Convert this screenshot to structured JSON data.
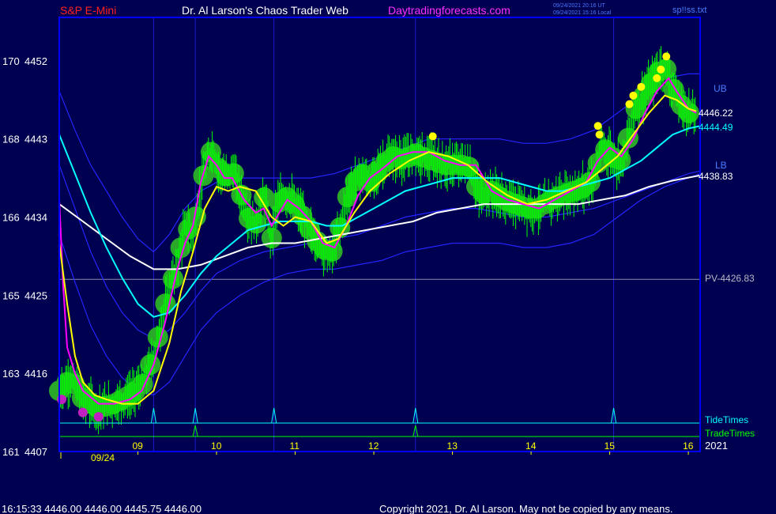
{
  "header": {
    "symbol": "S&P E-Mini",
    "site_title": "Dr. Al Larson's Chaos Trader Web",
    "url": "Daytradingforecasts.com",
    "utc_stamp": "09/24/2021 20:16 UT",
    "local_stamp": "09/24/2021 15:16 Local",
    "file_name": "sp!!ss.txt"
  },
  "footer": {
    "quote_line": "16:15:33  4446.00 4446.00 4445.75 4446.00",
    "copyright": "Copyright 2021, Dr. Al Larson. May not be copied by any means."
  },
  "colors": {
    "background": "#000050",
    "axis": "#0000ff",
    "grid": "#1a1ad0",
    "price_bars": "#00ff00",
    "halo": "#2aa82a",
    "magenta_ma": "#ff00ff",
    "yellow_ma": "#ffff00",
    "cyan_ma": "#00ffff",
    "white_ma": "#ffffff",
    "band": "#2424ff",
    "red_label": "#ff2020",
    "white_label": "#ffffff",
    "magenta_label": "#ff30ff",
    "band_label": "#4a7aff"
  },
  "chart_data": {
    "type": "line",
    "y_range_price": [
      4407,
      4457
    ],
    "left_axis_labels": [
      {
        "code": "170",
        "price": "4452"
      },
      {
        "code": "168",
        "price": "4443"
      },
      {
        "code": "166",
        "price": "4434"
      },
      {
        "code": "165",
        "price": "4425"
      },
      {
        "code": "163",
        "price": "4416"
      },
      {
        "code": "161",
        "price": "4407"
      }
    ],
    "x_range_hours": [
      8.0,
      16.15
    ],
    "x_tick_labels": [
      "09",
      "10",
      "11",
      "12",
      "13",
      "14",
      "15",
      "16"
    ],
    "x_tick_hours": [
      9,
      10,
      11,
      12,
      13,
      14,
      15,
      16
    ],
    "date_label": "09/24",
    "year_label": "2021",
    "vertical_lines_hours": [
      9.2,
      9.73,
      10.73,
      12.53,
      15.05
    ],
    "pivot": {
      "label": "PV-4426.83",
      "price": 4426.83
    },
    "right_labels": {
      "upper_band": "UB",
      "lower_band": "LB",
      "price_a": "4446.22",
      "price_b": "4444.49",
      "price_c": "4438.83"
    },
    "tide_times": {
      "label": "TideTimes",
      "spike_hours": [
        9.2,
        9.73,
        10.73,
        12.53,
        15.05
      ]
    },
    "trade_times": {
      "label": "TradeTimes",
      "spike_hours": [
        9.73,
        12.53
      ]
    },
    "price_series": {
      "hours": [
        8.0,
        8.15,
        8.3,
        8.5,
        8.7,
        8.9,
        9.05,
        9.2,
        9.35,
        9.5,
        9.6,
        9.7,
        9.78,
        9.85,
        9.95,
        10.0,
        10.1,
        10.2,
        10.3,
        10.4,
        10.5,
        10.6,
        10.7,
        10.75,
        10.85,
        10.95,
        11.1,
        11.25,
        11.35,
        11.45,
        11.55,
        11.65,
        11.75,
        11.85,
        11.95,
        12.1,
        12.25,
        12.4,
        12.5,
        12.6,
        12.75,
        12.9,
        13.05,
        13.2,
        13.35,
        13.5,
        13.65,
        13.8,
        13.95,
        14.1,
        14.25,
        14.4,
        14.55,
        14.7,
        14.8,
        14.9,
        15.0,
        15.1,
        15.2,
        15.3,
        15.4,
        15.5,
        15.6,
        15.7,
        15.8,
        15.9,
        16.0,
        16.1
      ],
      "close": [
        4414.0,
        4415.5,
        4413.0,
        4412.0,
        4412.5,
        4413.5,
        4414.5,
        4418.0,
        4424.0,
        4428.5,
        4433.0,
        4432.0,
        4436.5,
        4439.5,
        4442.0,
        4440.0,
        4438.5,
        4439.5,
        4437.0,
        4434.0,
        4433.0,
        4436.5,
        4431.5,
        4435.0,
        4436.5,
        4436.0,
        4434.0,
        4431.5,
        4430.5,
        4429.5,
        4432.0,
        4436.0,
        4438.0,
        4439.0,
        4438.0,
        4440.0,
        4441.0,
        4440.5,
        4441.5,
        4441.0,
        4440.5,
        4440.0,
        4440.0,
        4440.0,
        4436.5,
        4437.0,
        4436.0,
        4435.5,
        4435.0,
        4435.0,
        4436.0,
        4436.5,
        4437.0,
        4437.5,
        4438.5,
        4442.0,
        4441.5,
        4440.0,
        4441.5,
        4446.0,
        4447.5,
        4449.0,
        4450.5,
        4451.5,
        4449.0,
        4447.0,
        4446.0,
        4446.0
      ],
      "yellow_dot_hours": [
        12.75,
        14.85,
        14.87,
        15.25,
        15.3,
        15.4,
        15.6,
        15.65,
        15.72
      ],
      "yellow_dot_prices": [
        4443.3,
        4444.5,
        4443.5,
        4447.0,
        4448.0,
        4449.0,
        4450.0,
        4451.0,
        4452.5
      ],
      "magenta_dot_hours": [
        8.03,
        8.3,
        8.5
      ],
      "magenta_dot_prices": [
        4413.0,
        4411.5,
        4411.0
      ]
    },
    "yellow_ma": {
      "hours": [
        8.0,
        8.1,
        8.2,
        8.3,
        8.45,
        8.6,
        8.8,
        9.0,
        9.2,
        9.4,
        9.55,
        9.7,
        9.85,
        10.0,
        10.15,
        10.3,
        10.5,
        10.7,
        10.85,
        11.0,
        11.2,
        11.4,
        11.55,
        11.75,
        11.95,
        12.2,
        12.45,
        12.7,
        12.95,
        13.2,
        13.45,
        13.7,
        13.95,
        14.2,
        14.45,
        14.7,
        14.9,
        15.1,
        15.3,
        15.5,
        15.7,
        15.85,
        16.0,
        16.1
      ],
      "values": [
        4431,
        4424,
        4418,
        4415,
        4413.5,
        4413,
        4412.5,
        4412.5,
        4414,
        4419.5,
        4425.5,
        4430,
        4435,
        4437.5,
        4437,
        4437.5,
        4437,
        4434,
        4433,
        4434,
        4433.5,
        4431,
        4431.5,
        4434.5,
        4437,
        4439,
        4440.5,
        4441.5,
        4441,
        4440,
        4438,
        4436.5,
        4435.5,
        4436,
        4437,
        4438,
        4439.5,
        4441,
        4443.5,
        4446,
        4448,
        4447.5,
        4446.5,
        4446.2
      ]
    },
    "magenta_ma": {
      "hours": [
        8.0,
        8.05,
        8.1,
        8.2,
        8.3,
        8.5,
        8.7,
        8.9,
        9.05,
        9.2,
        9.35,
        9.5,
        9.6,
        9.7,
        9.8,
        9.9,
        10.0,
        10.1,
        10.2,
        10.35,
        10.5,
        10.6,
        10.7,
        10.8,
        10.9,
        11.05,
        11.2,
        11.35,
        11.5,
        11.65,
        11.8,
        11.95,
        12.1,
        12.3,
        12.5,
        12.7,
        12.9,
        13.1,
        13.3,
        13.5,
        13.7,
        13.9,
        14.1,
        14.3,
        14.5,
        14.7,
        14.85,
        15.0,
        15.15,
        15.3,
        15.45,
        15.6,
        15.75,
        15.85,
        16.0,
        16.1
      ],
      "values": [
        4436,
        4426,
        4419,
        4416,
        4414,
        4412.5,
        4412.5,
        4413,
        4414,
        4417,
        4422,
        4428,
        4431,
        4433,
        4438,
        4441,
        4440,
        4438.5,
        4438.5,
        4436,
        4434.5,
        4435,
        4433,
        4434.5,
        4436,
        4435,
        4433.5,
        4431,
        4430.5,
        4433,
        4436.5,
        4438.5,
        4439.5,
        4441,
        4441.5,
        4441.5,
        4440.5,
        4440,
        4440,
        4437,
        4436,
        4435.5,
        4435,
        4436,
        4437,
        4438,
        4440.5,
        4442,
        4441,
        4443,
        4446,
        4448.5,
        4450,
        4448.5,
        4446.5,
        4446
      ]
    },
    "cyan_ma": {
      "hours": [
        8.0,
        8.2,
        8.4,
        8.6,
        8.8,
        9.0,
        9.2,
        9.4,
        9.6,
        9.8,
        10.0,
        10.2,
        10.4,
        10.6,
        10.8,
        11.0,
        11.2,
        11.4,
        11.6,
        11.8,
        12.0,
        12.2,
        12.4,
        12.6,
        12.8,
        13.0,
        13.2,
        13.4,
        13.6,
        13.8,
        14.0,
        14.2,
        14.4,
        14.6,
        14.8,
        15.0,
        15.2,
        15.4,
        15.6,
        15.8,
        16.0,
        16.15
      ],
      "values": [
        4443.5,
        4439,
        4434.5,
        4430.5,
        4427,
        4424,
        4422.5,
        4423,
        4425,
        4427.5,
        4429.5,
        4431,
        4432.5,
        4433,
        4433.5,
        4433.5,
        4433.5,
        4433,
        4433,
        4434,
        4435,
        4436,
        4437,
        4437.5,
        4438,
        4438.5,
        4438.5,
        4438.5,
        4438.5,
        4438,
        4437.5,
        4437,
        4437,
        4437.5,
        4438,
        4438.5,
        4439.5,
        4440.5,
        4442,
        4443.5,
        4444.2,
        4444.5
      ]
    },
    "white_ma": {
      "hours": [
        8.0,
        8.3,
        8.6,
        8.9,
        9.2,
        9.5,
        9.8,
        10.1,
        10.4,
        10.7,
        11.0,
        11.3,
        11.6,
        11.9,
        12.2,
        12.5,
        12.8,
        13.1,
        13.4,
        13.7,
        14.0,
        14.3,
        14.6,
        14.9,
        15.2,
        15.5,
        15.8,
        16.15
      ],
      "values": [
        4435.5,
        4433.5,
        4431.5,
        4429.5,
        4428,
        4428,
        4428.5,
        4429.5,
        4430.5,
        4431,
        4431,
        4431.5,
        4432,
        4432.5,
        4433,
        4433.5,
        4434.5,
        4435,
        4435.5,
        4435.5,
        4435.5,
        4435.5,
        4435.5,
        4436,
        4436.5,
        4437.5,
        4438.2,
        4438.8
      ]
    },
    "upper_band": {
      "hours": [
        8.0,
        8.2,
        8.4,
        8.6,
        8.8,
        9.0,
        9.2,
        9.4,
        9.6,
        9.8,
        10.0,
        10.3,
        10.6,
        10.9,
        11.2,
        11.5,
        11.8,
        12.1,
        12.4,
        12.7,
        13.0,
        13.3,
        13.6,
        13.9,
        14.2,
        14.5,
        14.8,
        15.1,
        15.4,
        15.7,
        16.0,
        16.15
      ],
      "values": [
        4448.5,
        4444,
        4440,
        4437,
        4434,
        4431.5,
        4430,
        4432,
        4435,
        4437,
        4438,
        4438.5,
        4438.5,
        4438.5,
        4438.5,
        4439,
        4440,
        4441,
        4442,
        4443,
        4443,
        4443,
        4443,
        4442.5,
        4442.5,
        4443,
        4444,
        4446,
        4448,
        4450,
        4450.5,
        4450.5
      ]
    },
    "mid_band": {
      "hours": [
        8.0,
        8.2,
        8.4,
        8.6,
        8.8,
        9.0,
        9.2,
        9.4,
        9.6,
        9.8,
        10.0,
        10.3,
        10.6,
        10.9,
        11.2,
        11.5,
        11.8,
        12.1,
        12.4,
        12.7,
        13.0,
        13.3,
        13.6,
        13.9,
        14.2,
        14.5,
        14.8,
        15.1,
        15.4,
        15.7,
        16.0,
        16.15
      ],
      "values": [
        4440,
        4435,
        4430,
        4426,
        4423,
        4421,
        4420,
        4421,
        4423,
        4425.5,
        4427.5,
        4429,
        4430,
        4430.5,
        4431,
        4431.5,
        4432,
        4433,
        4434,
        4434.5,
        4435,
        4435,
        4434.5,
        4434,
        4434,
        4434.5,
        4435,
        4436,
        4437,
        4438,
        4439,
        4439.3
      ]
    },
    "lower_band": {
      "hours": [
        8.0,
        8.2,
        8.4,
        8.6,
        8.8,
        9.0,
        9.2,
        9.4,
        9.6,
        9.8,
        10.0,
        10.3,
        10.6,
        10.9,
        11.2,
        11.5,
        11.8,
        12.1,
        12.4,
        12.7,
        13.0,
        13.3,
        13.6,
        13.9,
        14.2,
        14.5,
        14.8,
        15.1,
        15.4,
        15.7,
        16.0,
        16.15
      ],
      "values": [
        4432,
        4426.5,
        4421.5,
        4418,
        4415.5,
        4414,
        4413.5,
        4415,
        4418,
        4421,
        4423,
        4425,
        4426.5,
        4427.5,
        4428,
        4428,
        4428.5,
        4429,
        4430,
        4430.5,
        4431,
        4431,
        4431,
        4430.5,
        4430.5,
        4431,
        4432,
        4434,
        4436,
        4437.5,
        4438.5,
        4439
      ]
    }
  }
}
